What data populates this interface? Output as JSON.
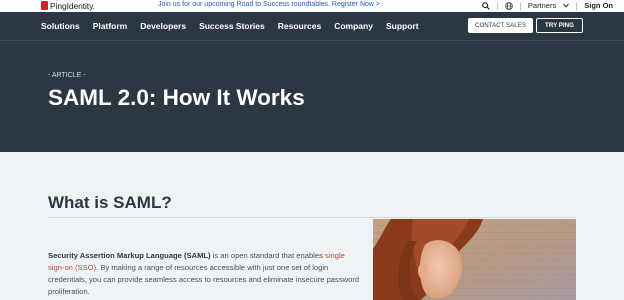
{
  "topbar": {
    "logo_text": "PingIdentity.",
    "announcement": "Join us for our upcoming Road to Success roundtables. Register Now >",
    "partners_label": "Partners",
    "signon_label": "Sign On",
    "icons": [
      "search-icon",
      "globe-icon",
      "chevron-down-icon"
    ]
  },
  "nav": {
    "items": [
      "Solutions",
      "Platform",
      "Developers",
      "Success Stories",
      "Resources",
      "Company",
      "Support"
    ],
    "contact_label": "CONTACT SALES",
    "try_label": "TRY PING"
  },
  "hero": {
    "eyebrow": "- ARTICLE -",
    "title": "SAML 2.0: How It Works"
  },
  "content": {
    "section_title": "What is SAML?",
    "para_bold": "Security Assertion Markup Language (SAML)",
    "para_text1": " is an open standard that enables ",
    "para_link": "single sign-on (SSO)",
    "para_text2": ". By making a range of resources accessible with just one set of login credentials, you can provide seamless access to resources and eliminate insecure password proliferation."
  },
  "colors": {
    "brand_red": "#d61f26",
    "nav_bg": "#2b3844",
    "page_bg": "#eef3f5",
    "link": "#1f5fbf"
  }
}
